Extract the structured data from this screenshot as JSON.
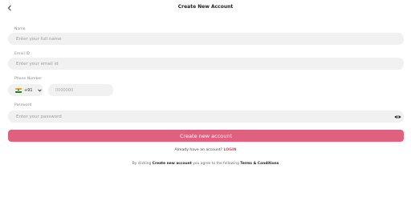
{
  "header": {
    "title": "Create New Account",
    "back_icon": "chevron-left-icon"
  },
  "form": {
    "name": {
      "label": "Name",
      "placeholder": "Enter your full name",
      "value": ""
    },
    "email": {
      "label": "Email ID",
      "placeholder": "Enter your email id",
      "value": ""
    },
    "phone": {
      "label": "Phone Number",
      "country_flag_icon": "india-flag-icon",
      "dial_code": "+91",
      "placeholder": "0000000",
      "value": ""
    },
    "password": {
      "label": "Password",
      "placeholder": "Enter your password",
      "value": "",
      "visibility_icon": "eye-icon"
    },
    "submit_label": "Create new account"
  },
  "footer": {
    "login_prompt": "Already have an account?",
    "login_link": "LOGIN",
    "terms_prefix": "By clicking",
    "terms_action": "Create new account",
    "terms_middle": "you agree to the following",
    "terms_link": "Terms & Conditions"
  },
  "colors": {
    "accent": "#e0607e",
    "link": "#d94a62",
    "field_bg": "#f1f1f1"
  }
}
